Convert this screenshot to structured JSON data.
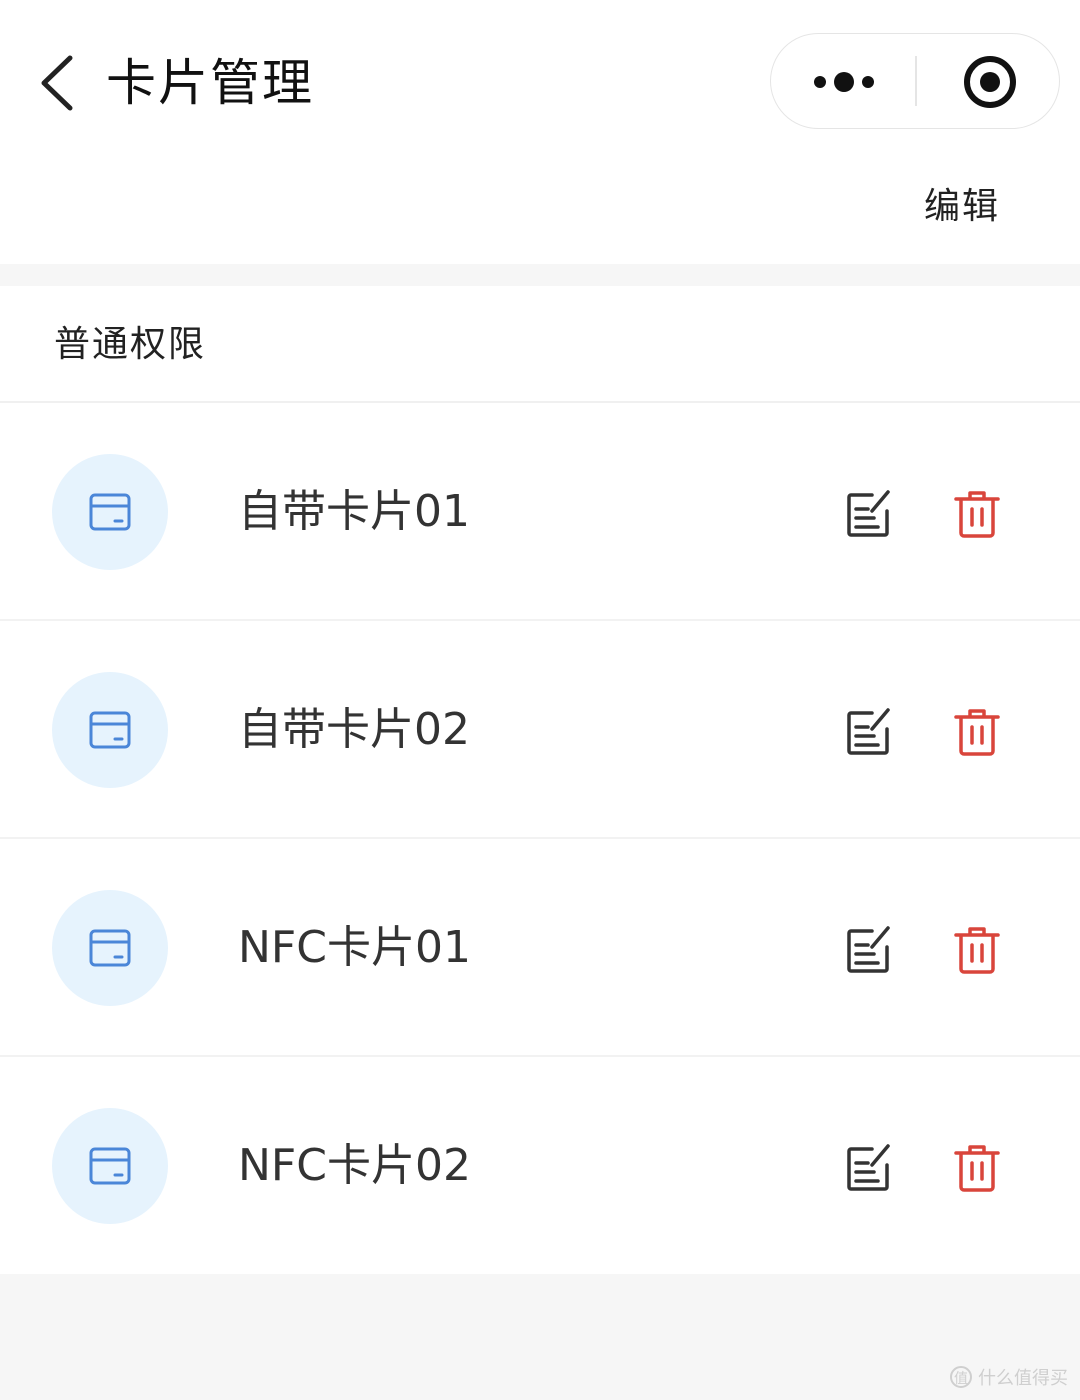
{
  "header": {
    "title": "卡片管理",
    "edit_label": "编辑"
  },
  "section": {
    "title": "普通权限",
    "cards": [
      {
        "name": "自带卡片01"
      },
      {
        "name": "自带卡片02"
      },
      {
        "name": "NFC卡片01"
      },
      {
        "name": "NFC卡片02"
      }
    ]
  },
  "icons": {
    "back": "chevron-left-icon",
    "more": "more-dots-icon",
    "close": "record-circle-icon",
    "card": "card-icon",
    "edit": "edit-note-icon",
    "delete": "trash-icon"
  },
  "colors": {
    "accent_blue": "#4a86d8",
    "avatar_bg": "#e6f3fd",
    "delete_red": "#d9453b",
    "icon_gray": "#333333"
  },
  "watermark": {
    "text": "什么值得买"
  }
}
